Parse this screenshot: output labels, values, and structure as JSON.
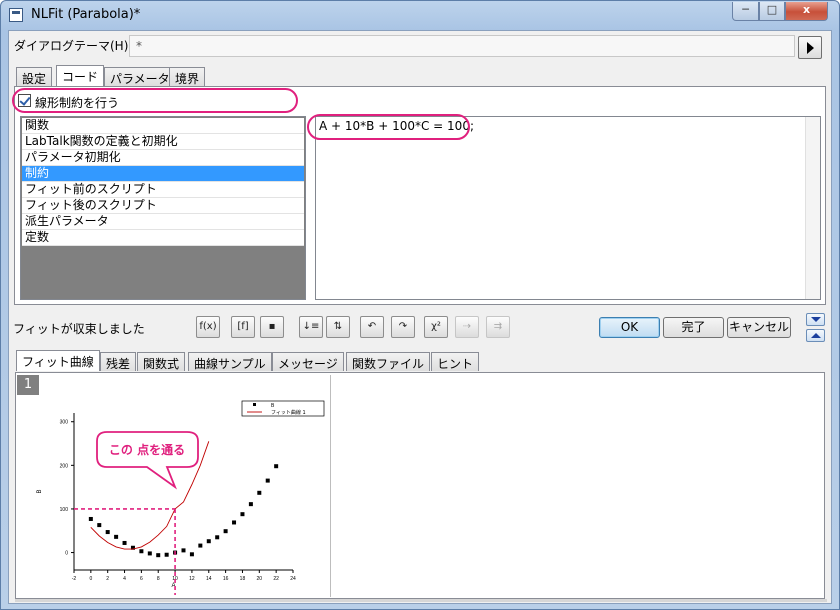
{
  "window": {
    "title": "NLFit (Parabola)*",
    "min_glyph": "─",
    "max_glyph": "□",
    "close_glyph": "x"
  },
  "theme": {
    "label": "ダイアログテーマ(H)",
    "value": "*"
  },
  "tabs": [
    "設定",
    "コード",
    "パラメータ",
    "境界"
  ],
  "active_tab": "コード",
  "linear_constraint": {
    "label": "線形制約を行う",
    "checked": true
  },
  "code_sections": [
    "関数",
    "LabTalk関数の定義と初期化",
    "パラメータ初期化",
    "制約",
    "フィット前のスクリプト",
    "フィット後のスクリプト",
    "派生パラメータ",
    "定数"
  ],
  "selected_section": "制約",
  "code_text": "A + 10*B + 100*C = 100;",
  "status_text": "フィットが収束しました",
  "toolbar": {
    "icons": [
      "fit-iteration-icon",
      "fit-function-icon",
      "save-icon",
      "sort-icon",
      "sort-alt-icon",
      "undo-icon",
      "redo-icon",
      "chi-square-icon",
      "fit-step-icon",
      "fit-until-converged-icon"
    ],
    "chi_label": "χ²"
  },
  "buttons": {
    "ok": "OK",
    "done": "完了",
    "cancel": "キャンセル"
  },
  "lower_tabs": [
    "フィット曲線",
    "残差",
    "関数式",
    "曲線サンプル",
    "メッセージ",
    "関数ファイル",
    "ヒント"
  ],
  "active_lower_tab": "フィット曲線",
  "graph_page": "1",
  "callout": "この 点を通る",
  "colors": {
    "accent": "#e0207e",
    "selection": "#3399ff",
    "fit_curve": "#c00000"
  },
  "chart_data": {
    "type": "scatter",
    "xlabel": "A",
    "ylabel": "B",
    "xlim": [
      -2,
      24
    ],
    "ylim": [
      -40,
      320
    ],
    "x_ticks": [
      "-2",
      "0",
      "2",
      "4",
      "6",
      "8",
      "10",
      "12",
      "14",
      "16",
      "18",
      "20",
      "22",
      "24"
    ],
    "y_ticks": [
      "0",
      "100",
      "200",
      "300"
    ],
    "legend": {
      "position": "top-right",
      "entries": [
        "B",
        "フィット曲線 1"
      ]
    },
    "series": [
      {
        "name": "B",
        "kind": "points",
        "x": [
          0,
          1,
          2,
          3,
          4,
          5,
          6,
          7,
          8,
          9,
          10,
          11,
          12,
          13,
          14,
          15,
          16,
          17,
          18,
          19,
          20,
          21,
          22
        ],
        "y": [
          77,
          63,
          47,
          36,
          22,
          11,
          3,
          -2,
          -6,
          -5,
          0,
          5,
          -4,
          16,
          26,
          35,
          49,
          69,
          88,
          111,
          137,
          165,
          198
        ]
      },
      {
        "name": "フィット曲線 1",
        "kind": "line",
        "x": [
          0,
          1,
          2,
          3,
          4,
          5,
          6,
          7,
          8,
          9,
          10,
          11,
          12,
          13,
          14
        ],
        "y": [
          58,
          38,
          23,
          13,
          8,
          8,
          13,
          24,
          40,
          60,
          100,
          116,
          156,
          200,
          255
        ]
      }
    ],
    "annotation_point": {
      "x": 10,
      "y": 100
    }
  }
}
